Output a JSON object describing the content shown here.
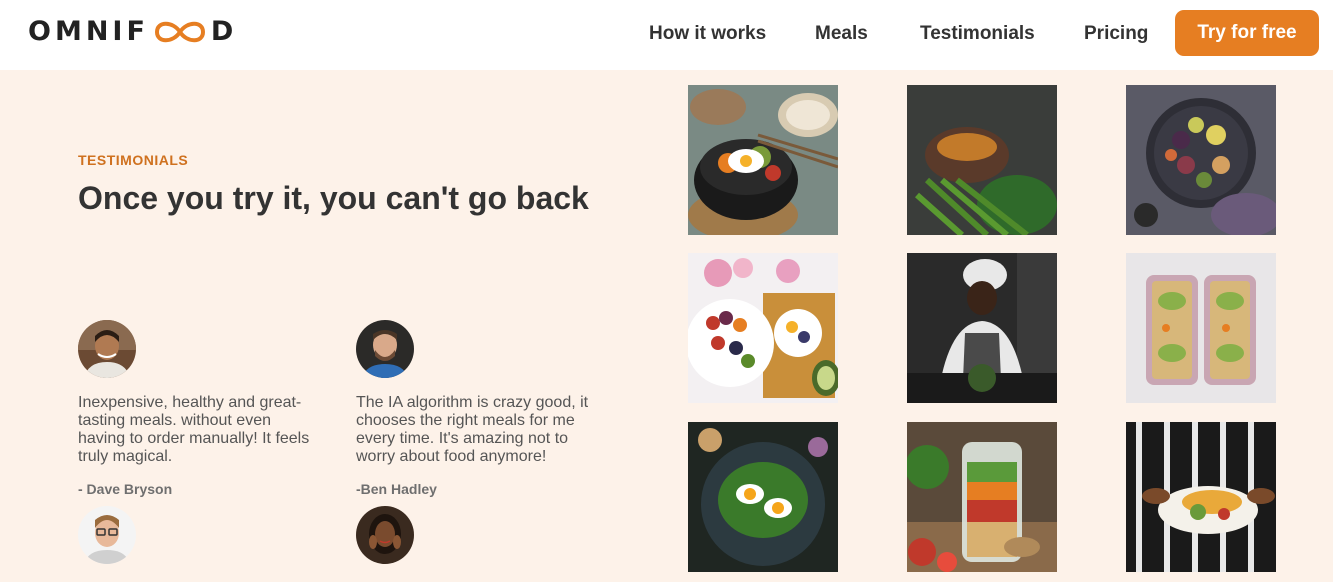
{
  "header": {
    "logo": "OMNIFOOD",
    "nav": [
      "How it works",
      "Meals",
      "Testimonials",
      "Pricing"
    ],
    "cta": "Try for free"
  },
  "section": {
    "subheading": "TESTIMONIALS",
    "heading": "Once you try it, you can't go back"
  },
  "testimonials": [
    {
      "quote": "Inexpensive, healthy and great-tasting meals. without even having to order manually! It feels truly magical.",
      "author": "- Dave Bryson"
    },
    {
      "quote": "The IA algorithm is crazy good, it chooses the right meals for me every time. It's amazing not to worry about food anymore!",
      "author": "-Ben Hadley"
    },
    {
      "quote": "",
      "author": ""
    },
    {
      "quote": "",
      "author": ""
    }
  ],
  "colors": {
    "brand": "#e67e22",
    "brand_dark": "#cf711f",
    "background": "#fdf2e9",
    "text": "#333333"
  }
}
